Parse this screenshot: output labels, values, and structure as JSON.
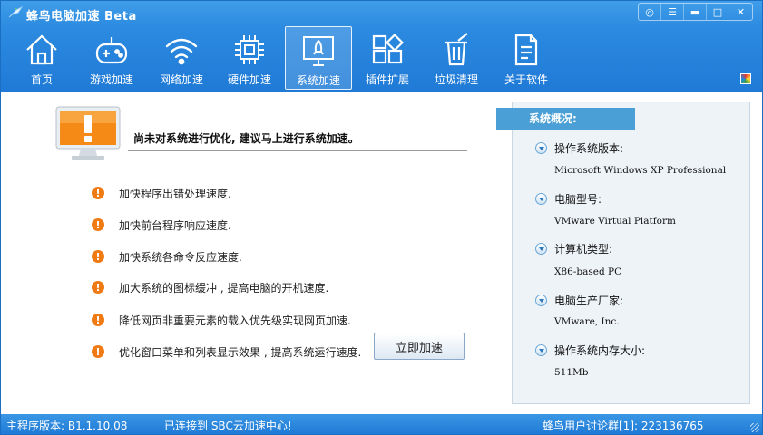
{
  "app": {
    "title": "蜂鸟电脑加速 Beta"
  },
  "window_controls": [
    {
      "name": "feedback-icon",
      "glyph": "◎"
    },
    {
      "name": "menu-icon",
      "glyph": "☰"
    },
    {
      "name": "minimize-icon",
      "glyph": "▬"
    },
    {
      "name": "maximize-icon",
      "glyph": "□"
    },
    {
      "name": "close-icon",
      "glyph": "✕"
    }
  ],
  "toolbar": {
    "items": [
      {
        "label": "首页",
        "icon": "home-icon"
      },
      {
        "label": "游戏加速",
        "icon": "gamepad-icon"
      },
      {
        "label": "网络加速",
        "icon": "wifi-icon"
      },
      {
        "label": "硬件加速",
        "icon": "chip-icon"
      },
      {
        "label": "系统加速",
        "icon": "rocket-monitor-icon",
        "active": true
      },
      {
        "label": "插件扩展",
        "icon": "plugins-icon"
      },
      {
        "label": "垃圾清理",
        "icon": "trash-icon"
      },
      {
        "label": "关于软件",
        "icon": "document-icon"
      }
    ]
  },
  "main": {
    "alert_text": "尚未对系统进行优化, 建议马上进行系统加速。",
    "benefits": [
      "加快程序出错处理速度.",
      "加快前台程序响应速度.",
      "加快系统各命令反应速度.",
      "加大系统的图标缓冲 , 提高电脑的开机速度.",
      "降低网页非重要元素的载入优先级实现网页加速.",
      "优化窗口菜单和列表显示效果 , 提高系统运行速度."
    ],
    "accelerate_button": "立即加速"
  },
  "panel": {
    "title": "系统概况:",
    "items": [
      {
        "label": "操作系统版本:",
        "value": "Microsoft Windows XP Professional"
      },
      {
        "label": "电脑型号:",
        "value": "VMware Virtual Platform"
      },
      {
        "label": "计算机类型:",
        "value": "X86-based PC"
      },
      {
        "label": "电脑生产厂家:",
        "value": "VMware, Inc."
      },
      {
        "label": "操作系统内存大小:",
        "value": "511Mb"
      }
    ]
  },
  "status": {
    "version": "主程序版本: B1.1.10.08",
    "connection": "已连接到 SBC云加速中心!",
    "group": "蜂鸟用户讨论群[1]: 223136765"
  },
  "colors": {
    "accent": "#1f7ad6",
    "warning": "#f07b14",
    "panel_head": "#4a9fd6"
  }
}
